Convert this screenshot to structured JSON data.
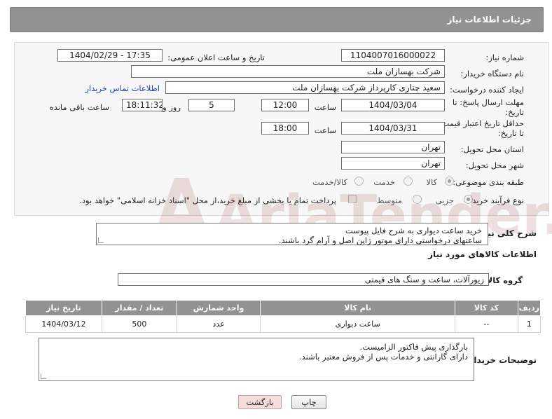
{
  "header": {
    "title": "جزئیات اطلاعات نیاز"
  },
  "form": {
    "need_number_label": "شماره نیاز:",
    "need_number": "1104007016000022",
    "announce_label": "تاریخ و ساعت اعلان عمومی:",
    "announce_value": "1404/02/29 - 17:35",
    "buyer_org_label": "نام دستگاه خریدار:",
    "buyer_org": "شرکت بهسازان ملت",
    "creator_label": "ایجاد کننده درخواست:",
    "creator": "سعید چناری کارپرداز شرکت بهسازان ملت",
    "contact_link": "اطلاعات تماس خریدار",
    "deadline_label": "مهلت ارسال پاسخ: تا تاریخ:",
    "deadline_date": "1404/03/04",
    "time_label": "ساعت",
    "deadline_time": "12:00",
    "days_value": "5",
    "days_label": "روز و",
    "remaining_time": "18:11:32",
    "remaining_label": "ساعت باقی مانده",
    "validity_label": "حداقل تاریخ اعتبار قیمت: تا تاریخ:",
    "validity_date": "1404/03/31",
    "validity_time": "18:00",
    "province_label": "استان محل تحویل:",
    "province": "تهران",
    "city_label": "شهر محل تحویل:",
    "city": "تهران",
    "category_label": "طبقه بندی موضوعی:",
    "category_options": [
      "کالا",
      "خدمت",
      "کالا/خدمت"
    ],
    "process_label": "نوع فرآیند خرید :",
    "process_options": [
      "جزیی",
      "متوسط"
    ],
    "payment_note": "پرداخت تمام یا بخشی از مبلغ خرید،از محل \"اسناد خزانه اسلامی\" خواهد بود."
  },
  "description": {
    "label": "شرح کلی نیاز:",
    "line1": "خرید ساعت دیواری به شرح فایل پیوست",
    "line2": "ساعتهای درخواستی دارای موتور ژاپن اصل و آرام گرد باشند."
  },
  "goods": {
    "section_title": "اطلاعات کالاهای مورد نیاز",
    "group_label": "گروه کالا:",
    "group_value": "زیورآلات، ساعت و سنگ های قیمتی",
    "columns": [
      "ردیف",
      "کد کالا",
      "نام کالا",
      "واحد شمارش",
      "تعداد / مقدار",
      "تاریخ نیاز"
    ],
    "rows": [
      {
        "row": "1",
        "code": "--",
        "name": "ساعت دیواری",
        "unit": "عدد",
        "qty": "500",
        "date": "1404/03/12"
      }
    ]
  },
  "notes": {
    "label": "توضیحات خریدار:",
    "line1": "بارگذاری پیش فاکتور الزامیست.",
    "line2": "دارای گارانتی و خدمات پس از فروش معتبر باشند."
  },
  "buttons": {
    "print": "چاپ",
    "back": "بازگشت"
  },
  "watermark": {
    "text": "AriaTender.neT",
    "icon": "aria-logo-icon"
  }
}
